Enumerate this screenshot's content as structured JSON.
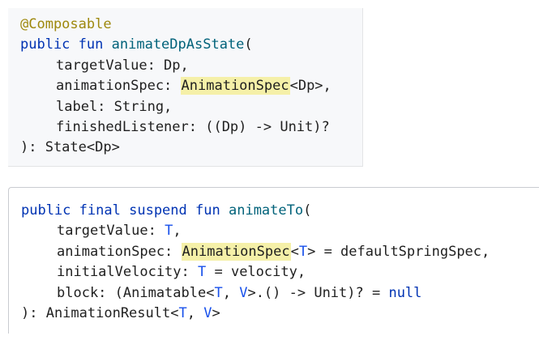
{
  "snippet_1": {
    "annotation": "@Composable",
    "keyword_public": "public",
    "keyword_fun": "fun",
    "function_name": "animateDpAsState",
    "open_paren": "(",
    "param_1": "targetValue: Dp,",
    "param_2_name": "animationSpec: ",
    "param_2_type_highlighted": "AnimationSpec",
    "param_2_type_rest": "<Dp>,",
    "param_3": "label: String,",
    "param_4": "finishedListener: ((Dp) -> Unit)?",
    "return_line": "): State<Dp>"
  },
  "snippet_2": {
    "keyword_public": "public",
    "keyword_final": "final",
    "keyword_suspend": "suspend",
    "keyword_fun": "fun",
    "function_name": "animateTo",
    "open_paren": "(",
    "param_1_name": "targetValue: ",
    "param_1_type": "T",
    "param_1_end": ",",
    "param_2_name": "animationSpec: ",
    "param_2_type_highlighted": "AnimationSpec",
    "param_2_lt": "<",
    "param_2_tparam": "T",
    "param_2_rest": "> = defaultSpringSpec,",
    "param_3_name": "initialVelocity: ",
    "param_3_type": "T",
    "param_3_rest": " = velocity,",
    "param_4_a": "block: (Animatable<",
    "param_4_t": "T",
    "param_4_comma": ", ",
    "param_4_v": "V",
    "param_4_b": ">.() -> Unit)? = ",
    "param_4_null": "null",
    "return_a": "): AnimationResult<",
    "return_t": "T",
    "return_comma": ", ",
    "return_v": "V",
    "return_b": ">"
  },
  "colors": {
    "annotation": "#9e880d",
    "keyword": "#0033b3",
    "function_name": "#00627a",
    "type_parameter": "#1750eb",
    "highlight": "#f5f0a8",
    "panel_background": "#f7f8fa"
  }
}
